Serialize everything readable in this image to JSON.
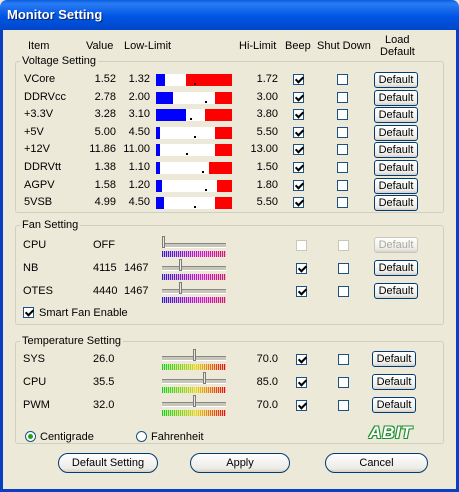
{
  "window": {
    "title": "Monitor Setting"
  },
  "headers": {
    "item": "Item",
    "value": "Value",
    "low": "Low-Limit",
    "hi": "Hi-Limit",
    "beep": "Beep",
    "shutdown": "Shut Down",
    "load1": "Load",
    "load2": "Default"
  },
  "voltage": {
    "title": "Voltage Setting",
    "rows": [
      {
        "item": "VCore",
        "value": "1.52",
        "low": "1.32",
        "hi": "1.72",
        "beep": true,
        "shutdown": false,
        "button": "Default",
        "blue": 0.12,
        "red": 0.6,
        "mark": 0.5
      },
      {
        "item": "DDRVcc",
        "value": "2.78",
        "low": "2.00",
        "hi": "3.00",
        "beep": true,
        "shutdown": false,
        "button": "Default",
        "blue": 0.22,
        "red": 0.22,
        "mark": 0.65
      },
      {
        "item": "+3.3V",
        "value": "3.28",
        "low": "3.10",
        "hi": "3.80",
        "beep": true,
        "shutdown": false,
        "button": "Default",
        "blue": 0.4,
        "red": 0.35,
        "mark": 0.45
      },
      {
        "item": "+5V",
        "value": "5.00",
        "low": "4.50",
        "hi": "5.50",
        "beep": true,
        "shutdown": false,
        "button": "Default",
        "blue": 0.05,
        "red": 0.22,
        "mark": 0.5
      },
      {
        "item": "+12V",
        "value": "11.86",
        "low": "11.00",
        "hi": "13.00",
        "beep": true,
        "shutdown": false,
        "button": "Default",
        "blue": 0.05,
        "red": 0.22,
        "mark": 0.4
      },
      {
        "item": "DDRVtt",
        "value": "1.38",
        "low": "1.10",
        "hi": "1.50",
        "beep": true,
        "shutdown": false,
        "button": "Default",
        "blue": 0.05,
        "red": 0.3,
        "mark": 0.6
      },
      {
        "item": "AGPV",
        "value": "1.58",
        "low": "1.20",
        "hi": "1.80",
        "beep": true,
        "shutdown": false,
        "button": "Default",
        "blue": 0.08,
        "red": 0.2,
        "mark": 0.65
      },
      {
        "item": "5VSB",
        "value": "4.99",
        "low": "4.50",
        "hi": "5.50",
        "beep": true,
        "shutdown": false,
        "button": "Default",
        "blue": 0.1,
        "red": 0.22,
        "mark": 0.5
      }
    ]
  },
  "fan": {
    "title": "Fan Setting",
    "rows": [
      {
        "item": "CPU",
        "value": "OFF",
        "low": "",
        "beep": false,
        "shutdown": false,
        "button": "Default",
        "disabled": true,
        "level": 0.0
      },
      {
        "item": "NB",
        "value": "4115",
        "low": "1467",
        "beep": true,
        "shutdown": false,
        "button": "Default",
        "disabled": false,
        "level": 0.28
      },
      {
        "item": "OTES",
        "value": "4440",
        "low": "1467",
        "beep": true,
        "shutdown": false,
        "button": "Default",
        "disabled": false,
        "level": 0.28
      }
    ],
    "smart_fan_label": "Smart Fan Enable",
    "smart_fan": true
  },
  "temperature": {
    "title": "Temperature Setting",
    "rows": [
      {
        "item": "SYS",
        "value": "26.0",
        "hi": "70.0",
        "beep": true,
        "shutdown": false,
        "button": "Default",
        "level": 0.5
      },
      {
        "item": "CPU",
        "value": "35.5",
        "hi": "85.0",
        "beep": true,
        "shutdown": false,
        "button": "Default",
        "level": 0.68
      },
      {
        "item": "PWM",
        "value": "32.0",
        "hi": "70.0",
        "beep": true,
        "shutdown": false,
        "button": "Default",
        "level": 0.5
      }
    ],
    "unit_c": "Centigrade",
    "unit_f": "Fahrenheit",
    "selected_unit": "Centigrade"
  },
  "logo": "ABIT",
  "footer": {
    "default": "Default Setting",
    "apply": "Apply",
    "cancel": "Cancel"
  },
  "colors": {
    "bar_low": "#0000FF",
    "bar_high": "#FF0000",
    "title_bar": "#0055E5",
    "check": "#21A121"
  }
}
